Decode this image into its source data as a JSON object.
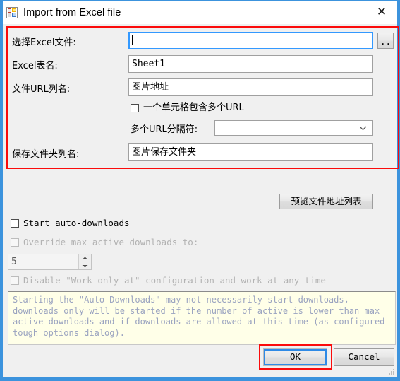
{
  "window": {
    "title": "Import from Excel file",
    "icon": "excel-grid-icon",
    "close_label": "✕",
    "border_color": "#3c93dd"
  },
  "annotations": {
    "color": "#fb0b0b",
    "boxes": [
      "excel-fields-group",
      "ok-button"
    ]
  },
  "form": {
    "fields": [
      {
        "label": "选择Excel文件:",
        "value": "",
        "focused": true
      },
      {
        "label": "Excel表名:",
        "value": "Sheet1",
        "focused": false
      },
      {
        "label": "文件URL列名:",
        "value": "图片地址",
        "focused": false
      },
      {
        "label": "保存文件夹列名:",
        "value": "图片保存文件夹",
        "focused": false
      }
    ],
    "browse_button": "..",
    "multi_url_checkbox": {
      "label": "一个单元格包含多个URL",
      "checked": false
    },
    "separator": {
      "label": "多个URL分隔符:",
      "value": "",
      "chevron": "⌄"
    }
  },
  "preview_button": {
    "label": "预览文件地址列表"
  },
  "options": {
    "start_auto_downloads": {
      "label": "Start auto-downloads",
      "checked": false,
      "enabled": true
    },
    "override_max_active": {
      "label": "Override max active downloads to:",
      "checked": false,
      "enabled": false
    },
    "max_active_value": "5",
    "disable_work_only_at": {
      "label": "Disable \"Work only at\" configuration and work at any time",
      "checked": false,
      "enabled": false
    }
  },
  "info": {
    "text": "Starting the \"Auto-Downloads\" may not necessarily start downloads,\ndownloads only will be started if the number of active is lower than max\nactive downloads and if downloads are allowed at this time (as configured\ntough options dialog)."
  },
  "footer": {
    "ok_label": "OK",
    "cancel_label": "Cancel"
  }
}
